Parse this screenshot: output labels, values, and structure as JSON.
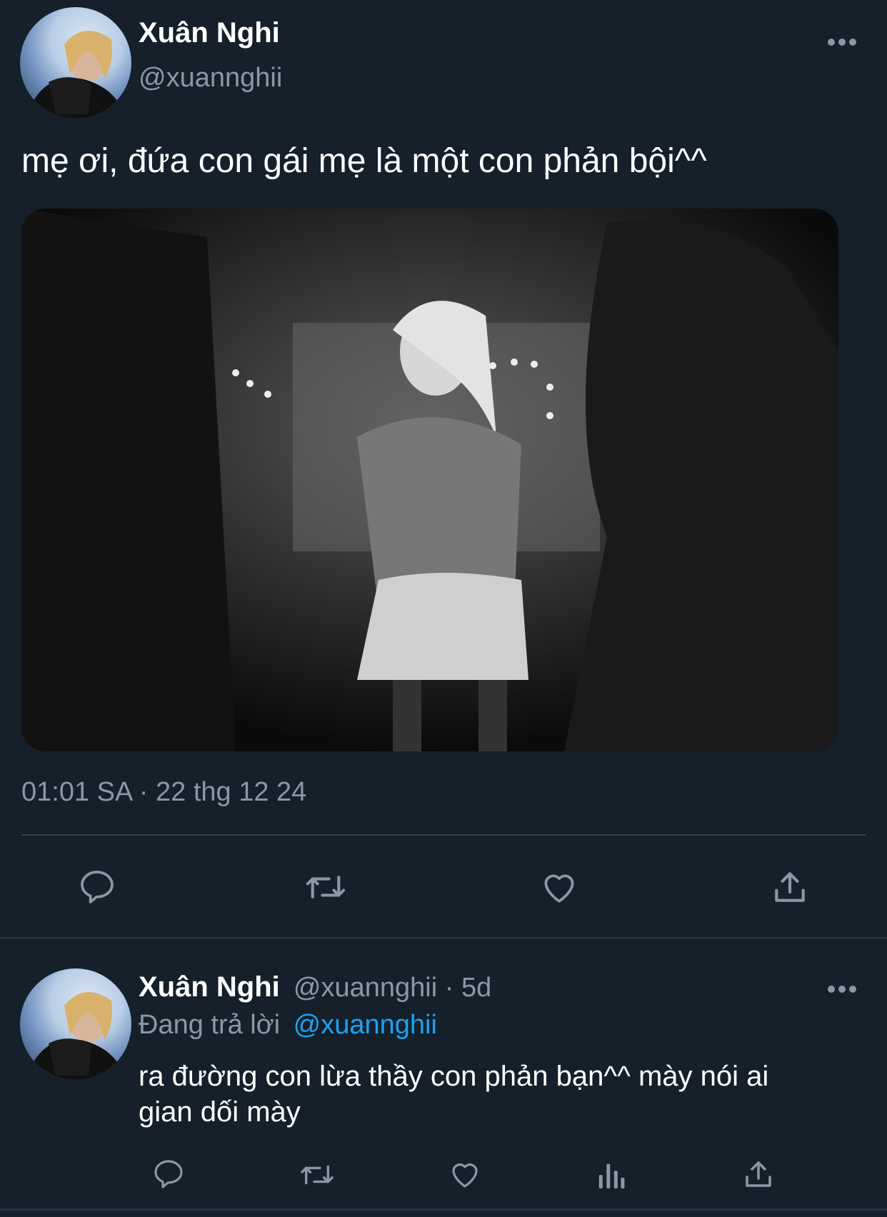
{
  "tweet": {
    "author_name": "Xuân Nghi",
    "author_handle": "@xuannghii",
    "more_icon": "more-horizontal-icon",
    "text": "mẹ ơi, đứa con gái mẹ là một con phản bội^^",
    "timestamp": "01:01 SA · 22 thg 12 24",
    "actions": [
      "reply-icon",
      "retweet-icon",
      "like-icon",
      "share-icon"
    ]
  },
  "reply": {
    "author_name": "Xuân Nghi",
    "meta": "@xuannghii · 5d",
    "replying_to_label": "Đang trả lời",
    "replying_to_handle": "@xuannghii",
    "text_line1": "ra đường con lừa thầy con phản bạn^^ mày nói ai",
    "text_line2": "gian dối mày",
    "actions": [
      "reply-icon",
      "retweet-icon",
      "like-icon",
      "analytics-icon",
      "share-icon"
    ]
  },
  "colors": {
    "background": "#15202b",
    "text_primary": "#ffffff",
    "text_secondary": "#8899a6",
    "accent": "#1da1f2",
    "divider": "#38444d"
  }
}
